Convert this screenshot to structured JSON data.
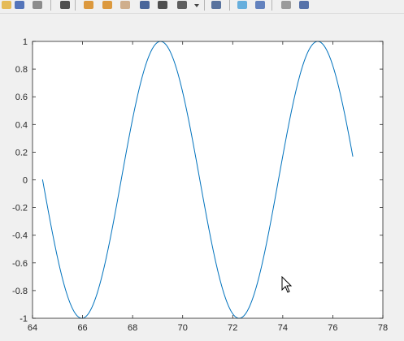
{
  "toolbar": {
    "buttons": [
      {
        "name": "open-file-icon",
        "color": "#e3b23c"
      },
      {
        "name": "save-icon",
        "color": "#3a5fb0"
      },
      {
        "name": "print-icon",
        "color": "#7a7a7a"
      },
      {
        "name": "pointer-icon",
        "color": "#333333"
      },
      {
        "name": "zoom-in-icon",
        "color": "#d88a1e"
      },
      {
        "name": "zoom-out-icon",
        "color": "#d88a1e"
      },
      {
        "name": "pan-hand-icon",
        "color": "#c9a27a"
      },
      {
        "name": "rotate-3d-icon",
        "color": "#2b4d8c"
      },
      {
        "name": "data-cursor-icon",
        "color": "#333333"
      },
      {
        "name": "brush-icon",
        "color": "#444444"
      },
      {
        "name": "brush-dropdown-icon",
        "color": "#444444"
      },
      {
        "name": "link-plot-icon",
        "color": "#3d5c8f"
      },
      {
        "name": "colorbar-icon",
        "color": "#4fa3d9"
      },
      {
        "name": "legend-icon",
        "color": "#4a6fb5"
      },
      {
        "name": "hide-plot-tools-icon",
        "color": "#8c8c8c"
      },
      {
        "name": "show-plot-tools-icon",
        "color": "#3c5c9c"
      }
    ]
  },
  "chart_data": {
    "type": "line",
    "title": "",
    "xlabel": "",
    "ylabel": "",
    "xlim": [
      64,
      78
    ],
    "ylim": [
      -1,
      1
    ],
    "x_ticks": [
      64,
      66,
      68,
      70,
      72,
      74,
      76,
      78
    ],
    "y_ticks": [
      -1,
      -0.8,
      -0.6,
      -0.4,
      -0.2,
      0,
      0.2,
      0.4,
      0.6,
      0.8,
      1
    ],
    "x_tick_labels": [
      "64",
      "66",
      "68",
      "70",
      "72",
      "74",
      "76",
      "78"
    ],
    "y_tick_labels": [
      "-1",
      "-0.8",
      "-0.6",
      "-0.4",
      "-0.2",
      "0",
      "0.2",
      "0.4",
      "0.6",
      "0.8",
      "1"
    ],
    "series": [
      {
        "function": "cos(x)",
        "x_range": [
          64.4,
          76.8
        ],
        "color": "#0072bd"
      }
    ],
    "grid": false,
    "background": "#ffffff"
  }
}
